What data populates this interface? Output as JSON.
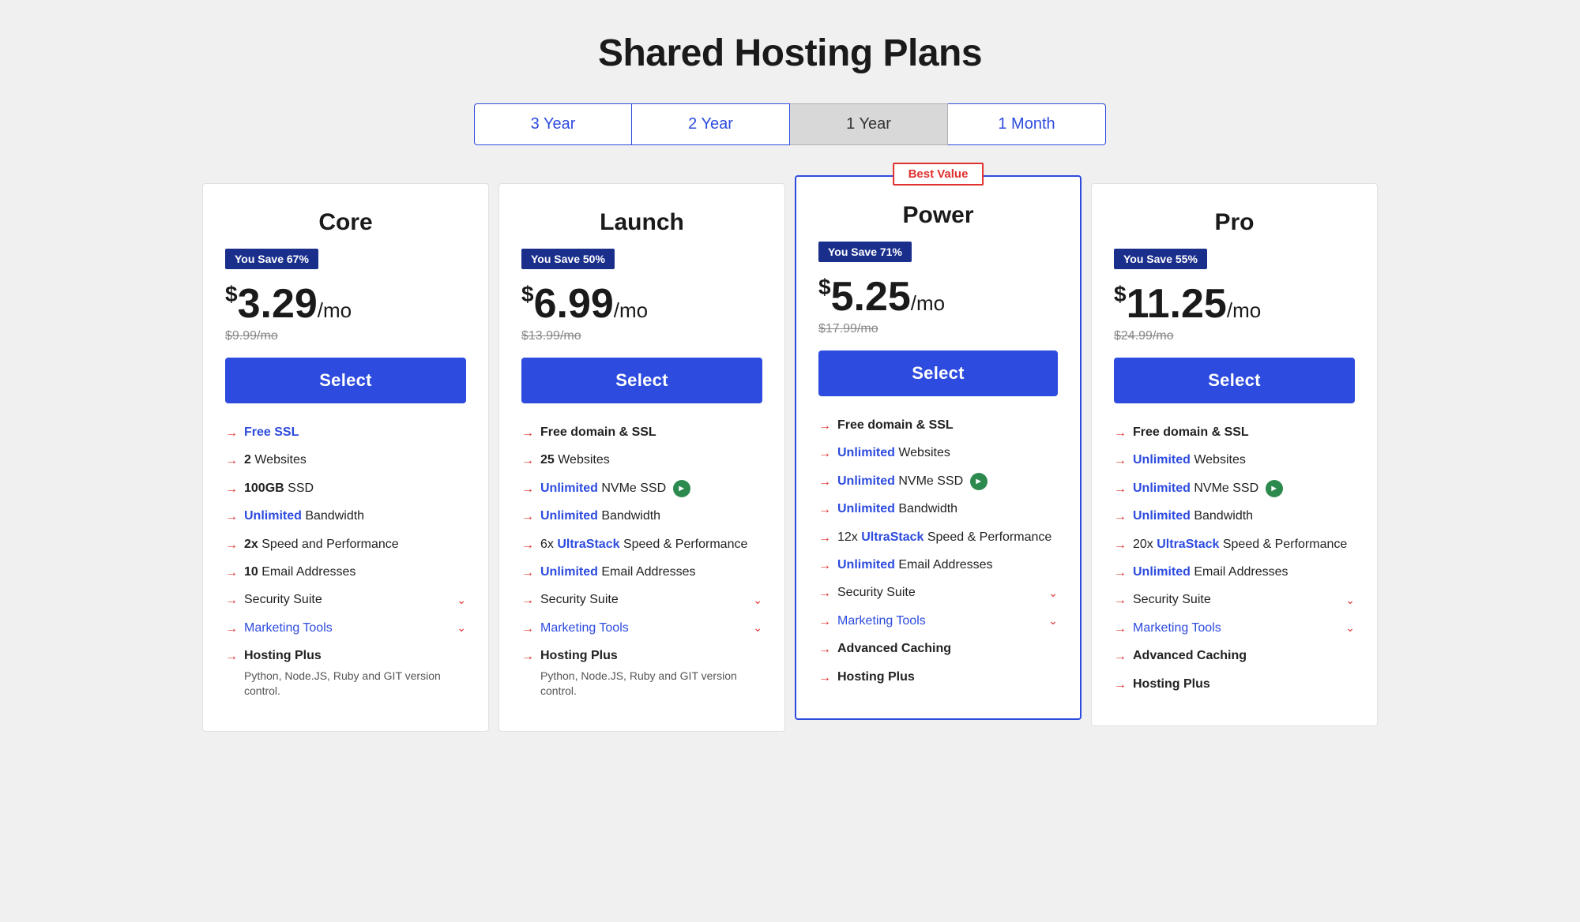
{
  "page": {
    "title": "Shared Hosting Plans"
  },
  "billing_tabs": [
    {
      "id": "3year",
      "label": "3 Year",
      "active": false
    },
    {
      "id": "2year",
      "label": "2 Year",
      "active": false
    },
    {
      "id": "1year",
      "label": "1 Year",
      "active": true
    },
    {
      "id": "1month",
      "label": "1 Month",
      "active": false
    }
  ],
  "plans": [
    {
      "id": "core",
      "name": "Core",
      "featured": false,
      "best_value": false,
      "savings": "You Save 67%",
      "price": "3.29",
      "price_suffix": "/mo",
      "original_price": "$9.99/mo",
      "select_label": "Select",
      "features": [
        {
          "type": "highlight-link",
          "text": "Free SSL"
        },
        {
          "type": "bold-normal",
          "bold": "2",
          "normal": " Websites"
        },
        {
          "type": "bold-normal",
          "bold": "100GB",
          "normal": " SSD"
        },
        {
          "type": "highlight-normal",
          "highlight": "Unlimited",
          "normal": " Bandwidth"
        },
        {
          "type": "bold-normal",
          "bold": "2x",
          "normal": " Speed and Performance"
        },
        {
          "type": "bold-normal",
          "bold": "10",
          "normal": " Email Addresses"
        },
        {
          "type": "expandable",
          "text": "Security Suite"
        },
        {
          "type": "expandable-link",
          "text": "Marketing Tools"
        },
        {
          "type": "bold-sub",
          "bold": "Hosting Plus",
          "sub": "Python, Node.JS, Ruby and GIT version control."
        }
      ]
    },
    {
      "id": "launch",
      "name": "Launch",
      "featured": false,
      "best_value": false,
      "savings": "You Save 50%",
      "price": "6.99",
      "price_suffix": "/mo",
      "original_price": "$13.99/mo",
      "select_label": "Select",
      "features": [
        {
          "type": "bold-normal",
          "bold": "Free domain & SSL"
        },
        {
          "type": "bold-normal",
          "bold": "25",
          "normal": " Websites"
        },
        {
          "type": "highlight-normal-speed",
          "highlight": "Unlimited",
          "normal": " NVMe SSD"
        },
        {
          "type": "highlight-normal",
          "highlight": "Unlimited",
          "normal": " Bandwidth"
        },
        {
          "type": "normal-highlight-normal",
          "pre": "6x ",
          "highlight": "UltraStack",
          "normal": " Speed & Performance"
        },
        {
          "type": "highlight-normal",
          "highlight": "Unlimited",
          "normal": " Email Addresses"
        },
        {
          "type": "expandable",
          "text": "Security Suite"
        },
        {
          "type": "expandable-link",
          "text": "Marketing Tools"
        },
        {
          "type": "bold-sub",
          "bold": "Hosting Plus",
          "sub": "Python, Node.JS, Ruby and GIT version control."
        }
      ]
    },
    {
      "id": "power",
      "name": "Power",
      "featured": true,
      "best_value": true,
      "best_value_label": "Best Value",
      "savings": "You Save 71%",
      "price": "5.25",
      "price_suffix": "/mo",
      "original_price": "$17.99/mo",
      "select_label": "Select",
      "features": [
        {
          "type": "bold-normal",
          "bold": "Free domain & SSL"
        },
        {
          "type": "highlight-normal",
          "highlight": "Unlimited",
          "normal": " Websites"
        },
        {
          "type": "highlight-normal-speed",
          "highlight": "Unlimited",
          "normal": " NVMe SSD"
        },
        {
          "type": "highlight-normal",
          "highlight": "Unlimited",
          "normal": " Bandwidth"
        },
        {
          "type": "normal-highlight-normal",
          "pre": "12x ",
          "highlight": "UltraStack",
          "normal": " Speed & Performance"
        },
        {
          "type": "highlight-normal",
          "highlight": "Unlimited",
          "normal": " Email Addresses"
        },
        {
          "type": "expandable",
          "text": "Security Suite"
        },
        {
          "type": "expandable-link",
          "text": "Marketing Tools"
        },
        {
          "type": "bold-only",
          "bold": "Advanced Caching"
        },
        {
          "type": "bold-only",
          "bold": "Hosting Plus"
        }
      ]
    },
    {
      "id": "pro",
      "name": "Pro",
      "featured": false,
      "best_value": false,
      "savings": "You Save 55%",
      "price": "11.25",
      "price_suffix": "/mo",
      "original_price": "$24.99/mo",
      "select_label": "Select",
      "features": [
        {
          "type": "bold-normal",
          "bold": "Free domain & SSL"
        },
        {
          "type": "highlight-normal",
          "highlight": "Unlimited",
          "normal": " Websites"
        },
        {
          "type": "highlight-normal-speed",
          "highlight": "Unlimited",
          "normal": " NVMe SSD"
        },
        {
          "type": "highlight-normal",
          "highlight": "Unlimited",
          "normal": " Bandwidth"
        },
        {
          "type": "normal-highlight-normal",
          "pre": "20x ",
          "highlight": "UltraStack",
          "normal": " Speed & Performance"
        },
        {
          "type": "highlight-normal",
          "highlight": "Unlimited",
          "normal": " Email Addresses"
        },
        {
          "type": "expandable",
          "text": "Security Suite"
        },
        {
          "type": "expandable-link",
          "text": "Marketing Tools"
        },
        {
          "type": "bold-only",
          "bold": "Advanced Caching"
        },
        {
          "type": "bold-only",
          "bold": "Hosting Plus"
        }
      ]
    }
  ]
}
